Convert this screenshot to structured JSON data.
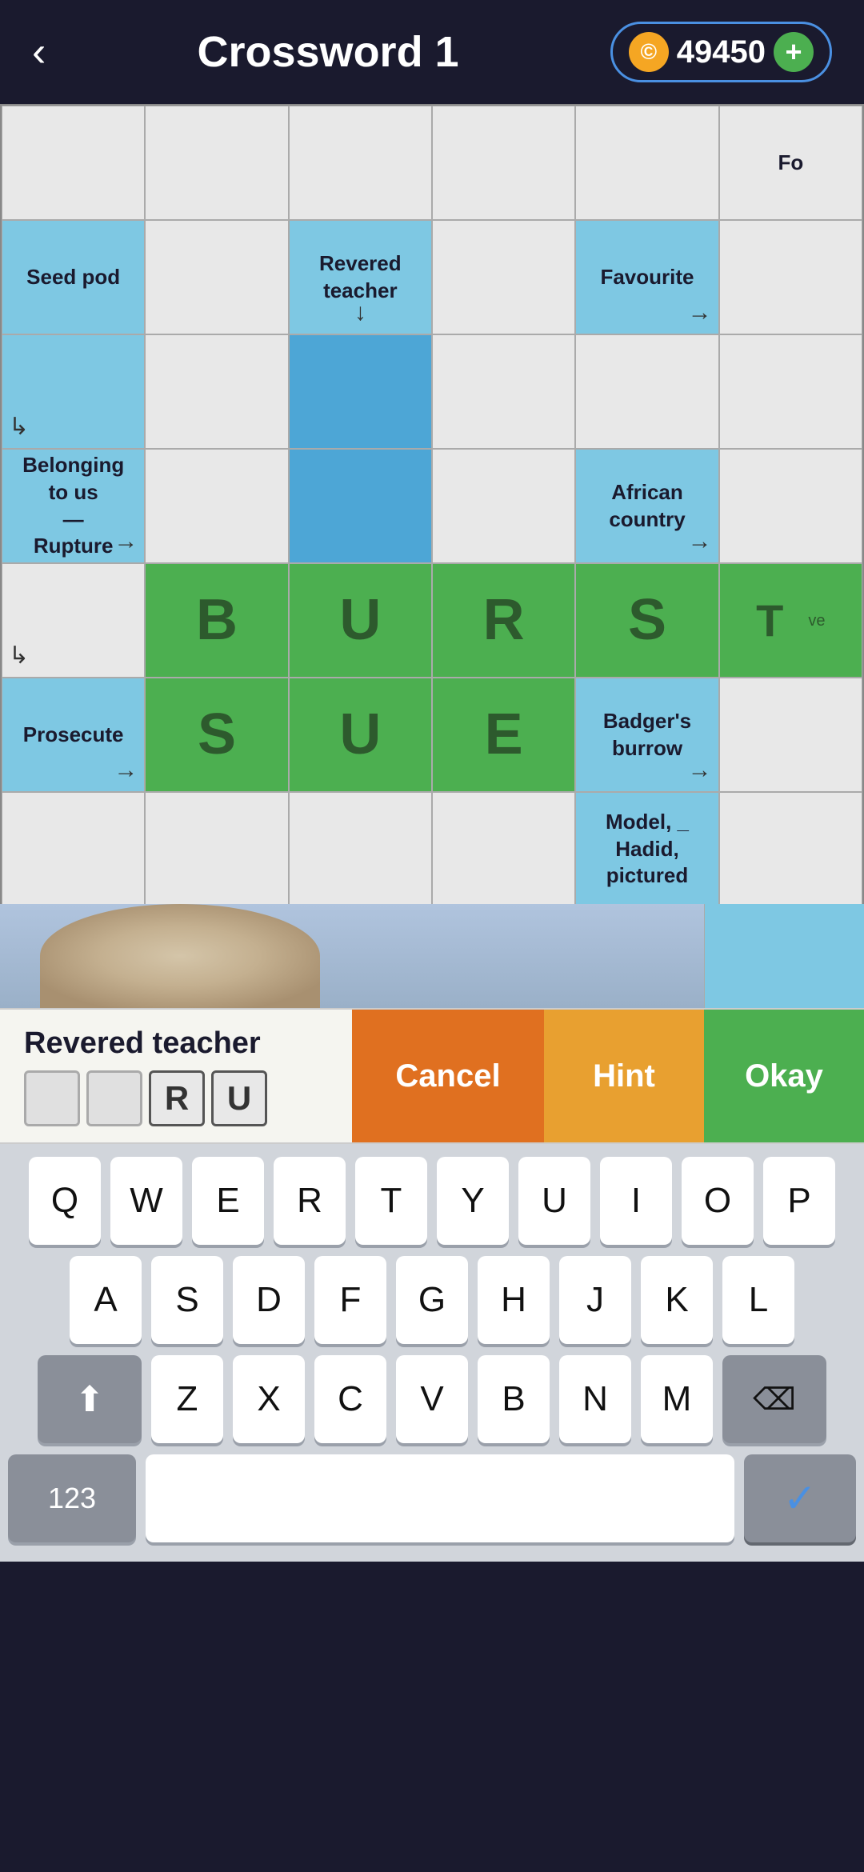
{
  "header": {
    "title": "Crossword 1",
    "back_label": "‹",
    "coins": "49450",
    "add_label": "+"
  },
  "grid": {
    "rows": [
      [
        {
          "type": "white",
          "text": ""
        },
        {
          "type": "white",
          "text": ""
        },
        {
          "type": "white",
          "text": ""
        },
        {
          "type": "white",
          "text": ""
        },
        {
          "type": "white",
          "text": ""
        },
        {
          "type": "white",
          "text": "Fo"
        }
      ],
      [
        {
          "type": "blue_light",
          "clue": "Seed pod",
          "arrow": ""
        },
        {
          "type": "white",
          "text": ""
        },
        {
          "type": "blue_light",
          "clue": "Revered\nteacher",
          "arrow": "down"
        },
        {
          "type": "white",
          "text": ""
        },
        {
          "type": "blue_light",
          "clue": "Favourite",
          "arrow": "right"
        },
        {
          "type": "white",
          "text": ""
        }
      ],
      [
        {
          "type": "blue_light",
          "arrow": "corner",
          "text": ""
        },
        {
          "type": "white",
          "text": ""
        },
        {
          "type": "blue_mid",
          "text": ""
        },
        {
          "type": "white",
          "text": ""
        },
        {
          "type": "white",
          "text": ""
        },
        {
          "type": "white",
          "text": ""
        }
      ],
      [
        {
          "type": "blue_light",
          "clue": "Belonging\nto us\n—\nRupture",
          "arrow": "right"
        },
        {
          "type": "white",
          "text": ""
        },
        {
          "type": "blue_mid",
          "text": ""
        },
        {
          "type": "white",
          "text": ""
        },
        {
          "type": "blue_light",
          "clue": "African\ncountry",
          "arrow": "right"
        },
        {
          "type": "white",
          "text": ""
        }
      ],
      [
        {
          "type": "white",
          "arrow": "corner",
          "text": ""
        },
        {
          "type": "green",
          "letter": "B"
        },
        {
          "type": "green",
          "letter": "U"
        },
        {
          "type": "green",
          "letter": "R"
        },
        {
          "type": "green",
          "letter": "S"
        },
        {
          "type": "green",
          "letter": "T"
        }
      ],
      [
        {
          "type": "blue_light",
          "clue": "Prosecute",
          "arrow": "right"
        },
        {
          "type": "green",
          "letter": "S"
        },
        {
          "type": "green",
          "letter": "U"
        },
        {
          "type": "green",
          "letter": "E"
        },
        {
          "type": "blue_light",
          "clue": "Badger's\nburrow",
          "arrow": "right"
        },
        {
          "type": "white",
          "text": ""
        }
      ],
      [
        {
          "type": "white",
          "text": ""
        },
        {
          "type": "white",
          "text": ""
        },
        {
          "type": "white",
          "text": ""
        },
        {
          "type": "white",
          "text": ""
        },
        {
          "type": "blue_light",
          "clue": "Model, _\nHadid,\npictured",
          "arrow": ""
        },
        {
          "type": "white",
          "text": ""
        }
      ]
    ]
  },
  "clue_bar": {
    "clue_text": "Revered teacher",
    "cancel_label": "Cancel",
    "hint_label": "Hint",
    "okay_label": "Okay",
    "answer_letters": [
      "",
      "",
      "R",
      "U"
    ]
  },
  "keyboard": {
    "row1": [
      "Q",
      "W",
      "E",
      "R",
      "T",
      "Y",
      "U",
      "I",
      "O",
      "P"
    ],
    "row2": [
      "A",
      "S",
      "D",
      "F",
      "G",
      "H",
      "J",
      "K",
      "L"
    ],
    "row3_left": "⬆",
    "row3_middle": [
      "Z",
      "X",
      "C",
      "V",
      "B",
      "N",
      "M"
    ],
    "row3_right": "⌫",
    "bottom_left": "123",
    "bottom_right_icon": "✓"
  }
}
